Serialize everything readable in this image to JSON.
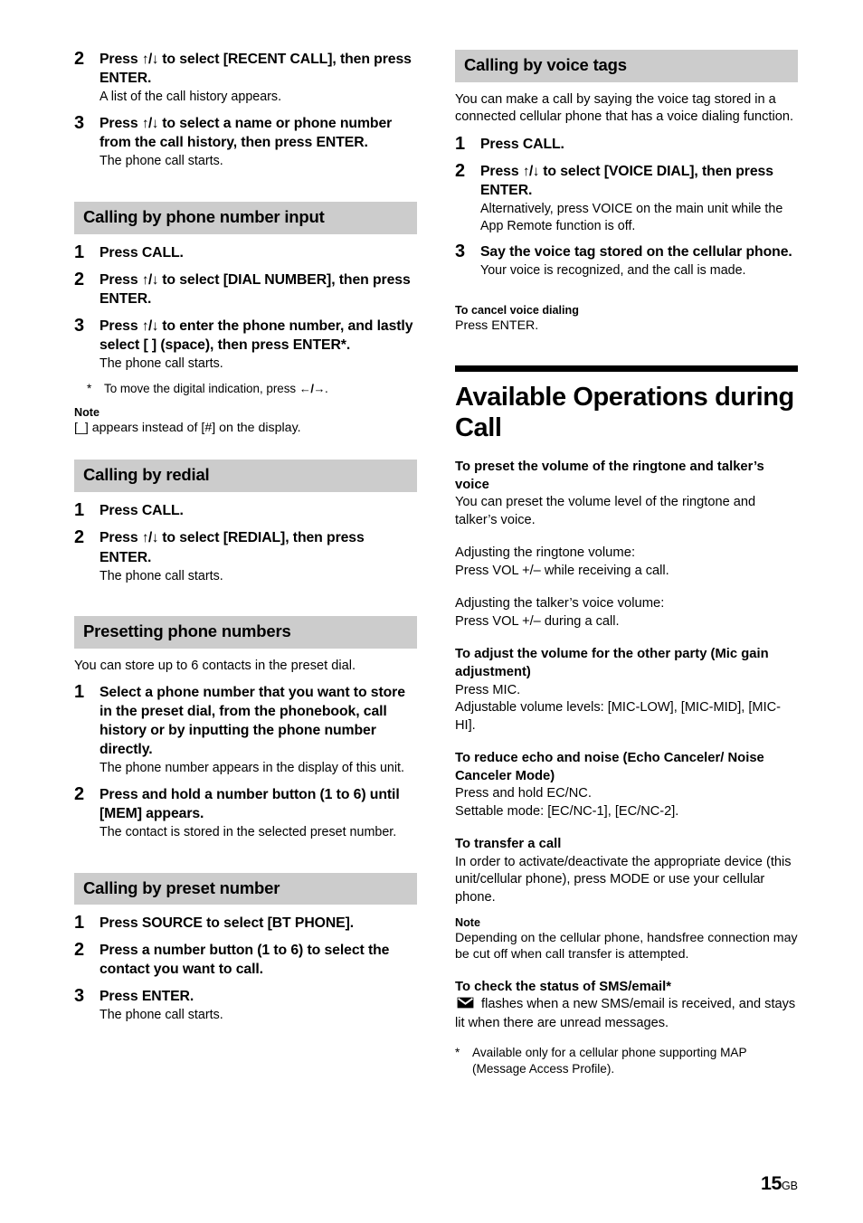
{
  "page": {
    "number": "15",
    "suffix": "GB"
  },
  "left_column": {
    "continued_steps": [
      {
        "num": "2",
        "text_before": "Press ",
        "arrows": "↑/↓",
        "text_after": " to select [RECENT CALL], then press ENTER.",
        "sub": "A list of the call history appears."
      },
      {
        "num": "3",
        "text_before": "Press ",
        "arrows": "↑/↓",
        "text_after": " to select a name or phone number from the call history, then press ENTER.",
        "sub": "The phone call starts."
      }
    ],
    "section_phone_number_input": {
      "heading": "Calling by phone number input",
      "steps": [
        {
          "num": "1",
          "text_before": "Press CALL.",
          "arrows": "",
          "text_after": "",
          "sub": ""
        },
        {
          "num": "2",
          "text_before": "Press ",
          "arrows": "↑/↓",
          "text_after": " to select [DIAL NUMBER], then press ENTER.",
          "sub": ""
        },
        {
          "num": "3",
          "text_before": "Press ",
          "arrows": "↑/↓",
          "text_after": " to enter the phone number, and lastly select [ ] (space), then press ENTER*.",
          "sub": "The phone call starts."
        }
      ],
      "footnote": {
        "star": "*",
        "text_before": "To move the digital indication, press ",
        "arrows": "←/→",
        "text_after": "."
      },
      "note_heading": "Note",
      "note_text": "[_] appears instead of [#] on the display."
    },
    "section_redial": {
      "heading": "Calling by redial",
      "steps": [
        {
          "num": "1",
          "text_before": "Press CALL.",
          "arrows": "",
          "text_after": "",
          "sub": ""
        },
        {
          "num": "2",
          "text_before": "Press ",
          "arrows": "↑/↓",
          "text_after": " to select [REDIAL], then press ENTER.",
          "sub": "The phone call starts."
        }
      ]
    },
    "section_presetting": {
      "heading": "Presetting phone numbers",
      "intro": "You can store up to 6 contacts in the preset dial.",
      "steps": [
        {
          "num": "1",
          "text_before": "Select a phone number that you want to store in the preset dial, from the phonebook, call history or by inputting the phone number directly.",
          "arrows": "",
          "text_after": "",
          "sub": "The phone number appears in the display of this unit."
        },
        {
          "num": "2",
          "text_before": "Press and hold a number button (1 to 6) until [MEM] appears.",
          "arrows": "",
          "text_after": "",
          "sub": "The contact is stored in the selected preset number."
        }
      ]
    },
    "section_preset_number": {
      "heading": "Calling by preset number",
      "steps": [
        {
          "num": "1",
          "text_before": "Press SOURCE to select [BT PHONE].",
          "arrows": "",
          "text_after": "",
          "sub": ""
        },
        {
          "num": "2",
          "text_before": "Press a number button (1 to 6) to select the contact you want to call.",
          "arrows": "",
          "text_after": "",
          "sub": ""
        },
        {
          "num": "3",
          "text_before": "Press ENTER.",
          "arrows": "",
          "text_after": "",
          "sub": "The phone call starts."
        }
      ]
    }
  },
  "right_column": {
    "section_voice_tags": {
      "heading": "Calling by voice tags",
      "intro": "You can make a call by saying the voice tag stored in a connected cellular phone that has a voice dialing function.",
      "steps": [
        {
          "num": "1",
          "text_before": "Press CALL.",
          "arrows": "",
          "text_after": "",
          "sub": ""
        },
        {
          "num": "2",
          "text_before": "Press ",
          "arrows": "↑/↓",
          "text_after": " to select [VOICE DIAL], then press ENTER.",
          "sub": "Alternatively, press VOICE on the main unit while the App Remote function is off."
        },
        {
          "num": "3",
          "text_before": "Say the voice tag stored on the cellular phone.",
          "arrows": "",
          "text_after": "",
          "sub": "Your voice is recognized, and the call is made."
        }
      ],
      "cancel_heading": "To cancel voice dialing",
      "cancel_text": "Press ENTER."
    },
    "chapter": {
      "title": "Available Operations during Call"
    },
    "topics": [
      {
        "heading": "To preset the volume of the ringtone and talker’s voice",
        "body": "You can preset the volume level of the ringtone and talker’s voice."
      },
      {
        "heading": "Adjusting the ringtone volume:",
        "body": "Press VOL +/– while receiving a call."
      },
      {
        "heading": "Adjusting the talker’s voice volume:",
        "body": "Press VOL +/– during a call."
      },
      {
        "heading": "To adjust the volume for the other party (Mic gain adjustment)",
        "body": "Press MIC.\nAdjustable volume levels: [MIC-LOW], [MIC-MID], [MIC-HI]."
      },
      {
        "heading": "To reduce echo and noise (Echo Canceler/ Noise Canceler Mode)",
        "body": "Press and hold EC/NC.\nSettable mode: [EC/NC-1], [EC/NC-2]."
      },
      {
        "heading": "To transfer a call",
        "body": "In order to activate/deactivate the appropriate device (this unit/cellular phone), press MODE or use your cellular phone."
      }
    ],
    "transfer_note": {
      "heading": "Note",
      "text": "Depending on the cellular phone, handsfree connection may be cut off when call transfer is attempted."
    },
    "section_sms": {
      "heading": "To check the status of SMS/email*",
      "icon": "envelope-icon",
      "body": " flashes when a new SMS/email is received, and stays lit when there are unread messages.",
      "footnote": {
        "star": "*",
        "text": "Available only for a cellular phone supporting MAP (Message Access Profile)."
      }
    }
  }
}
